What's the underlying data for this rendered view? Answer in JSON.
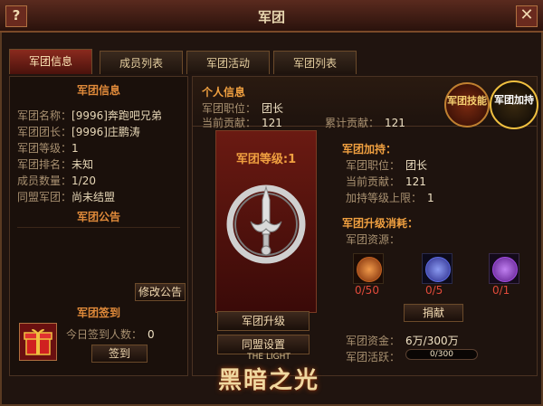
{
  "window": {
    "title": "军团",
    "help": "?",
    "close": "✕"
  },
  "tabs": [
    {
      "label": "军团信息",
      "active": true
    },
    {
      "label": "成员列表",
      "active": false
    },
    {
      "label": "军团活动",
      "active": false
    },
    {
      "label": "军团列表",
      "active": false
    }
  ],
  "left": {
    "info_header": "军团信息",
    "rows": [
      {
        "k": "军团名称：",
        "v": "[9996]奔跑吧兄弟"
      },
      {
        "k": "军团团长：",
        "v": "[9996]庄鹏涛"
      },
      {
        "k": "军团等级：",
        "v": "1"
      },
      {
        "k": "军团排名：",
        "v": "未知"
      },
      {
        "k": "成员数量：",
        "v": "1/20"
      },
      {
        "k": "同盟军团：",
        "v": "尚未结盟"
      }
    ],
    "notice_header": "军团公告",
    "edit_notice": "修改公告",
    "signin_header": "军团签到",
    "signin_count_label": "今日签到人数：",
    "signin_count": "0",
    "signin_button": "签到"
  },
  "personal": {
    "header": "个人信息",
    "position_label": "军团职位：",
    "position": "团长",
    "current_contrib_label": "当前贡献：",
    "current_contrib": "121",
    "total_contrib_label": "累计贡献：",
    "total_contrib": "121"
  },
  "side_buttons": {
    "skill": "军团技能",
    "boost": "军团加持"
  },
  "banner": {
    "level_label": "军团等级:",
    "level": "1",
    "upgrade_button": "军团升级",
    "alliance_button": "同盟设置"
  },
  "boost": {
    "header": "军团加持：",
    "position_label": "军团职位：",
    "position": "团长",
    "current_contrib_label": "当前贡献：",
    "current_contrib": "121",
    "limit_label": "加持等级上限：",
    "limit": "1"
  },
  "upgrade": {
    "header": "军团升级消耗：",
    "resource_label": "军团资源：",
    "resources": [
      {
        "icon": "orange-rune-icon",
        "value": "0/50",
        "color": "#e06a2a"
      },
      {
        "icon": "blue-rune-icon",
        "value": "0/5",
        "color": "#5a6ae0"
      },
      {
        "icon": "purple-rune-icon",
        "value": "0/1",
        "color": "#a04ae0"
      }
    ],
    "donate_button": "捐献",
    "fund_label": "军团资金：",
    "fund": "6万/300万",
    "activity_label": "军团活跃：",
    "activity": "0/300",
    "activity_ratio": 0
  },
  "logo": {
    "text": "黑暗之光",
    "subtitle": "THE LIGHT"
  }
}
